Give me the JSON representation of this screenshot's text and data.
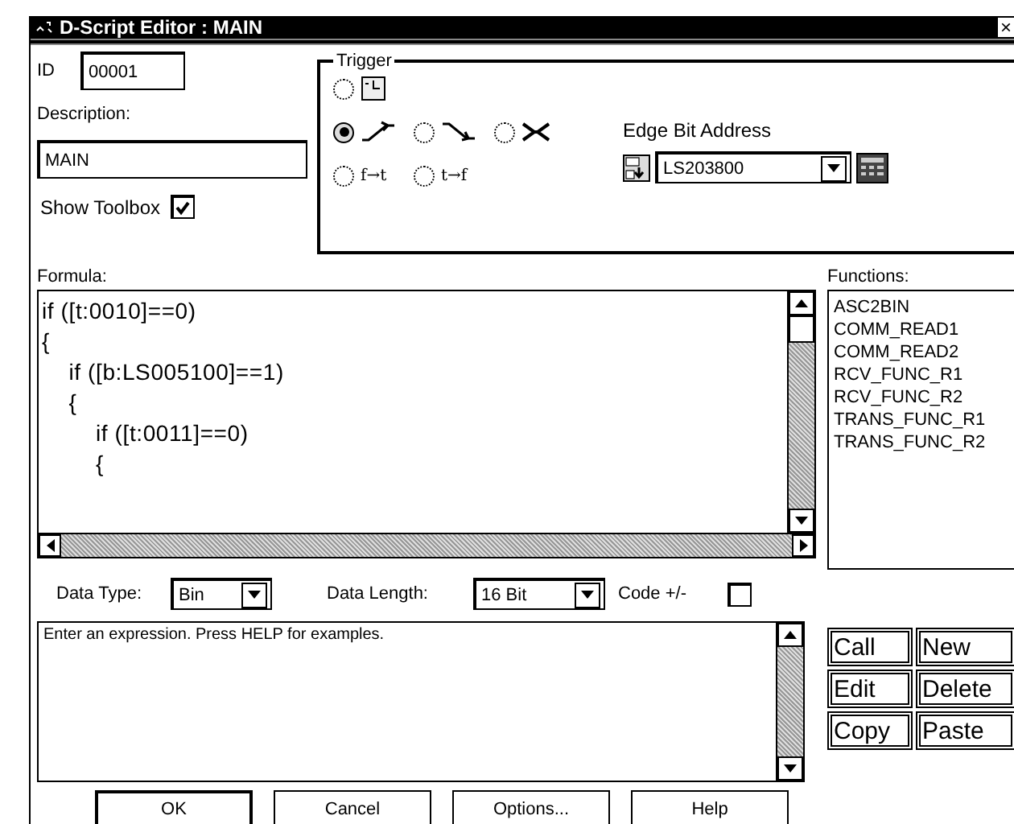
{
  "window": {
    "title": "D-Script Editor : MAIN",
    "close": "×"
  },
  "id": {
    "label": "ID",
    "value": "00001"
  },
  "description": {
    "label": "Description:",
    "value": "MAIN"
  },
  "show_toolbox": {
    "label": "Show Toolbox",
    "checked": true
  },
  "trigger": {
    "title": "Trigger",
    "options": [
      {
        "kind": "timer",
        "selected": false
      },
      {
        "kind": "rise",
        "selected": true
      },
      {
        "kind": "fall",
        "selected": false
      },
      {
        "kind": "change",
        "selected": false
      },
      {
        "kind": "text",
        "label": "f→t",
        "selected": false
      },
      {
        "kind": "text",
        "label": "t→f",
        "selected": false
      }
    ],
    "edge_label": "Edge Bit Address",
    "edge_value": "LS203800"
  },
  "formula": {
    "label": "Formula:",
    "lines": [
      "if ([t:0010]==0)",
      "{",
      "    if ([b:LS005100]==1)",
      "    {",
      "        if ([t:0011]==0)",
      "        {"
    ]
  },
  "functions": {
    "label": "Functions:",
    "items": [
      {
        "label": "ASC2BIN",
        "selected": false
      },
      {
        "label": "COMM_READ1",
        "selected": false
      },
      {
        "label": "COMM_READ2",
        "selected": false
      },
      {
        "label": "RCV_FUNC_R1",
        "selected": false
      },
      {
        "label": "RCV_FUNC_R2",
        "selected": false
      },
      {
        "label": "TRANS_FUNC_R1",
        "selected": false
      },
      {
        "label": "TRANS_FUNC_R2",
        "selected": false
      }
    ]
  },
  "data_type": {
    "label": "Data Type:",
    "value": "Bin"
  },
  "data_length": {
    "label": "Data Length:",
    "value": "16 Bit"
  },
  "code_sign": {
    "label": "Code +/-",
    "checked": false
  },
  "message": "Enter an expression. Press HELP for examples.",
  "function_buttons": [
    "Call",
    "New",
    "Edit",
    "Delete",
    "Copy",
    "Paste"
  ],
  "buttons": [
    {
      "label": "OK",
      "default": true
    },
    {
      "label": "Cancel",
      "default": false
    },
    {
      "label": "Options...",
      "default": false
    },
    {
      "label": "Help",
      "default": false
    }
  ]
}
